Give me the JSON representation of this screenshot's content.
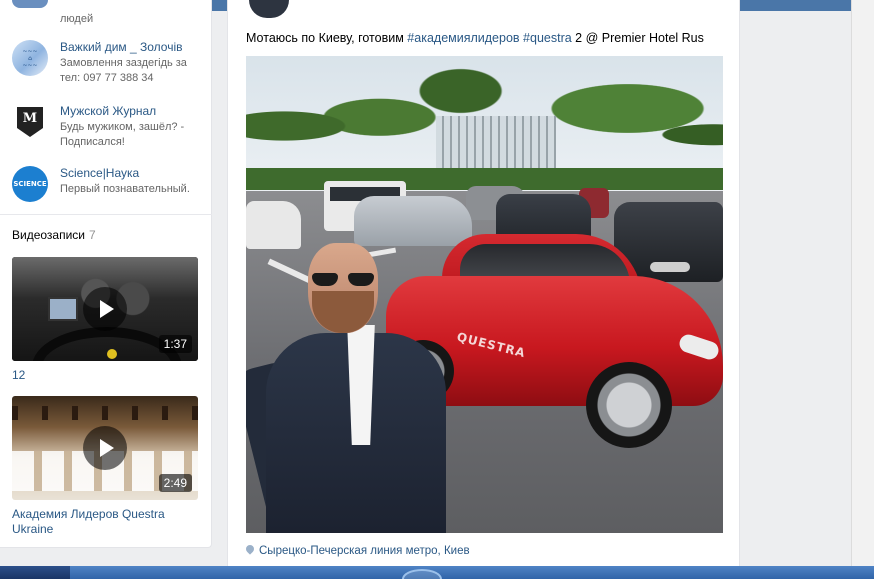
{
  "sidebar": {
    "partial_group_desc": "людей",
    "groups": [
      {
        "name": "Важкий дим _ Золочів",
        "desc": "Замовлення заздегідь за тел: 097 77 388 34",
        "icon": "house-logo"
      },
      {
        "name": "Мужской Журнал",
        "desc": "Будь мужиком, зашёл? - Подписался!",
        "icon": "m-shield-logo",
        "logo_letter": "M"
      },
      {
        "name": "Science|Наука",
        "desc": "Первый познавательный.",
        "icon": "science-logo",
        "logo_text": "SCIENCE"
      }
    ],
    "videos_header": "Видеозаписи",
    "videos_count": "7",
    "videos": [
      {
        "duration": "1:37",
        "title": "12"
      },
      {
        "duration": "2:49",
        "title": "Академия Лидеров Questra Ukraine"
      }
    ]
  },
  "post": {
    "text_prefix": "Мотаюсь по Киеву, готовим ",
    "hashtag1": "#академиялидеров",
    "text_middle": " ",
    "hashtag2": "#questra",
    "text_suffix": " 2 @ Premier Hotel Rus",
    "car_logo": "QUESTRA",
    "location": "Сырецко-Печерская линия метро, Киев"
  },
  "colors": {
    "header": "#4a76a8",
    "link": "#2a5885",
    "background": "#edeef0"
  }
}
